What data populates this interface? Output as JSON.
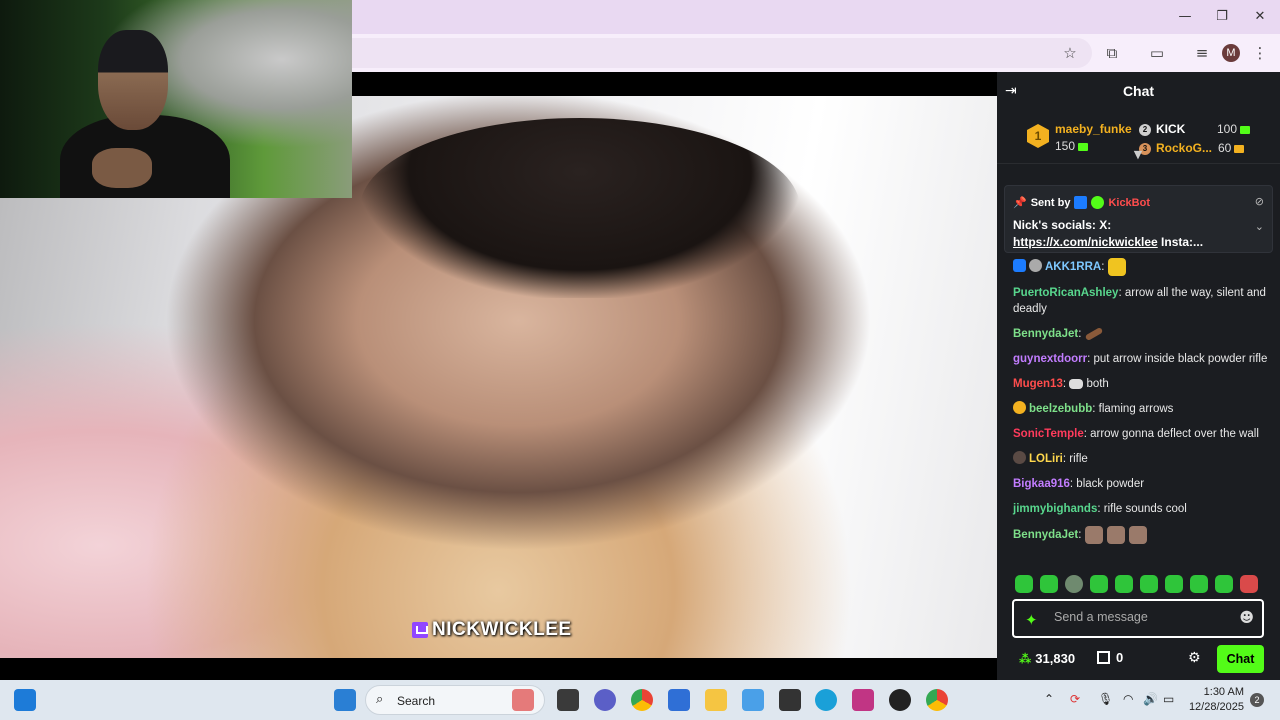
{
  "browser": {
    "profile_initial": "M",
    "window_controls": [
      "minimize",
      "maximize",
      "close"
    ]
  },
  "video": {
    "watermark": "NICKWICKLEE"
  },
  "chat": {
    "title": "Chat",
    "leaderboard": {
      "first": {
        "rank": "1",
        "name": "maeby_funke",
        "points": "150"
      },
      "second": {
        "rank": "2",
        "name": "KICK",
        "points": "100"
      },
      "third": {
        "rank": "3",
        "name": "RockoG...",
        "points": "60"
      }
    },
    "pinned": {
      "sent_by_label": "Sent by",
      "sender": "KickBot",
      "message_prefix": "Nick's socials: X:",
      "message_link": "https://x.com/nickwicklee",
      "message_suffix": " Insta:..."
    },
    "messages": [
      {
        "user": "AKK1RRA",
        "color": "#7ec8ff",
        "text": ""
      },
      {
        "user": "PuertoRicanAshley",
        "color": "#58d68d",
        "text": "arrow all the way, silent and deadly"
      },
      {
        "user": "BennydaJet",
        "color": "#7ee08a",
        "text": ""
      },
      {
        "user": "guynextdoorr",
        "color": "#c27dff",
        "text": "put arrow inside black powder rifle"
      },
      {
        "user": "Mugen13",
        "color": "#ff4d4d",
        "text": "both"
      },
      {
        "user": "beelzebubb",
        "color": "#7ee08a",
        "text": "flaming arrows"
      },
      {
        "user": "SonicTemple",
        "color": "#ff3b5c",
        "text": "arrow gonna deflect over the wall"
      },
      {
        "user": "LOLiri",
        "color": "#ffd84d",
        "text": "rifle"
      },
      {
        "user": "Bigkaa916",
        "color": "#c27dff",
        "text": "black powder"
      },
      {
        "user": "jimmybighands",
        "color": "#58d68d",
        "text": "rifle sounds cool"
      },
      {
        "user": "BennydaJet",
        "color": "#7ee08a",
        "text": ""
      }
    ],
    "input_placeholder": "Send a message",
    "points_balance": "31,830",
    "gift_count": "0",
    "send_label": "Chat",
    "accent_color": "#53fc18"
  },
  "taskbar": {
    "search_label": "Search",
    "time": "1:30 AM",
    "date": "12/28/2025",
    "notification_count": "2"
  }
}
